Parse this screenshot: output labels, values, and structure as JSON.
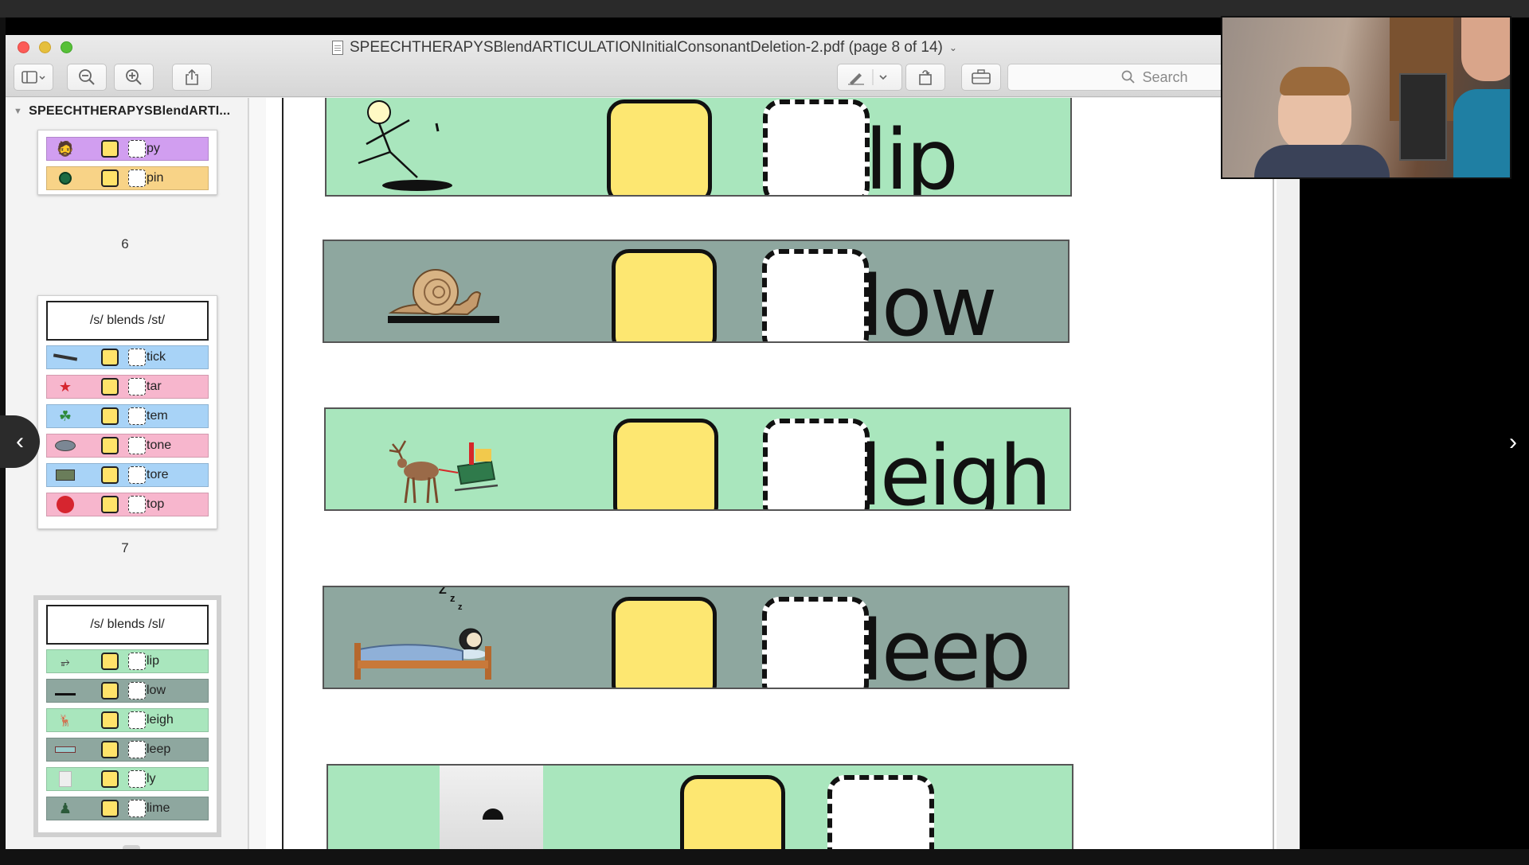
{
  "window": {
    "title": "SPEECHTHERAPYSBlendARTICULATIONInitialConsonantDeletion-2.pdf (page 8 of 14)",
    "search_placeholder": "Search"
  },
  "sidebar": {
    "document_name": "SPEECHTHERAPYSBlendARTI...",
    "pages": [
      {
        "number": "6",
        "header": "",
        "rows": [
          {
            "word": "py",
            "color": "#d19ef0",
            "icon": "person-icon"
          },
          {
            "word": "pin",
            "color": "#f8d387",
            "icon": "circle-icon"
          }
        ]
      },
      {
        "number": "7",
        "header": "/s/ blends   /st/",
        "rows": [
          {
            "word": "tick",
            "color": "#a8d3f7",
            "icon": "stick-icon"
          },
          {
            "word": "tar",
            "color": "#f7b6cd",
            "icon": "star-icon"
          },
          {
            "word": "tem",
            "color": "#a8d3f7",
            "icon": "plant-icon"
          },
          {
            "word": "tone",
            "color": "#f7b6cd",
            "icon": "stone-icon"
          },
          {
            "word": "tore",
            "color": "#a8d3f7",
            "icon": "store-icon"
          },
          {
            "word": "top",
            "color": "#f7b6cd",
            "icon": "stop-sign-icon"
          }
        ]
      },
      {
        "number": "8",
        "header": "/s/ blends   /sl/",
        "rows": [
          {
            "word": "lip",
            "color": "#a9e6bd",
            "icon": "slip-icon"
          },
          {
            "word": "low",
            "color": "#8ea79f",
            "icon": "snail-icon"
          },
          {
            "word": "leigh",
            "color": "#a9e6bd",
            "icon": "sleigh-icon"
          },
          {
            "word": "leep",
            "color": "#8ea79f",
            "icon": "sleep-icon"
          },
          {
            "word": "ly",
            "color": "#a9e6bd",
            "icon": "fox-icon"
          },
          {
            "word": "lime",
            "color": "#8ea79f",
            "icon": "slime-icon"
          }
        ]
      }
    ]
  },
  "document": {
    "cards": [
      {
        "word": "lip",
        "color": "#a9e6bd"
      },
      {
        "word": "low",
        "color": "#8ea79f"
      },
      {
        "word": "leigh",
        "color": "#a9e6bd"
      },
      {
        "word": "leep",
        "color": "#8ea79f"
      },
      {
        "word": "",
        "color": "#a9e6bd"
      }
    ]
  }
}
